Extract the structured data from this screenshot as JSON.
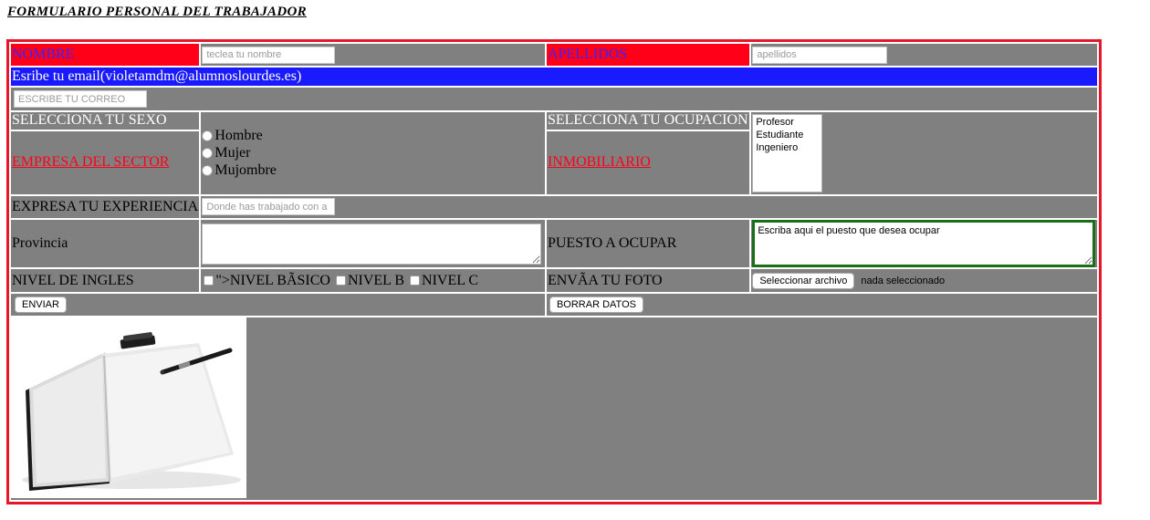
{
  "page_title": "FORMULARIO PERSONAL DEL TRABAJADOR",
  "colors": {
    "form_border": "#e8162b",
    "cell_bg": "#808080",
    "red_cell": "#ff0018",
    "blue_row": "#1a1aff",
    "label_blue_text": "#3b22ff",
    "puesto_border": "#1a6e1a"
  },
  "form": {
    "nombre": {
      "label": "NOMBRE",
      "placeholder": "teclea tu nombre",
      "value": ""
    },
    "apellidos": {
      "label": "APELLIDOS",
      "placeholder": "apellidos",
      "value": ""
    },
    "email": {
      "label": "Esribe tu email(violetamdm@alumnoslourdes.es)",
      "placeholder": "escribe tu correo",
      "value": ""
    },
    "sexo": {
      "label": "SELECCIONA TU SEXO",
      "options": [
        "Hombre",
        "Mujer",
        "Mujombre"
      ]
    },
    "ocupacion": {
      "label": "SELECCIONA TU OCUPACION",
      "options": [
        "Profesor",
        "Estudiante",
        "Ingeniero"
      ]
    },
    "empresa_link": "EMPRESA DEL SECTOR",
    "inmobiliario_link": "INMOBILIARIO",
    "experiencia": {
      "label": "EXPRESA TU EXPERIENCIA",
      "placeholder": "Donde has trabajado con a",
      "value": ""
    },
    "provincia": {
      "label": "Provincia",
      "value": ""
    },
    "puesto": {
      "label": "PUESTO A OCUPAR",
      "placeholder": "Escriba aqui el puesto que desea ocupar"
    },
    "ingles": {
      "label": "NIVEL DE INGLES",
      "options": [
        "\">NIVEL BÃSICO",
        "NIVEL B",
        "NIVEL C"
      ]
    },
    "foto": {
      "label": "ENVÃA TU FOTO",
      "button": "Seleccionar archivo",
      "status": "nada seleccionado"
    },
    "enviar_button": "ENVIAR",
    "borrar_button": "BORRAR DATOS"
  }
}
